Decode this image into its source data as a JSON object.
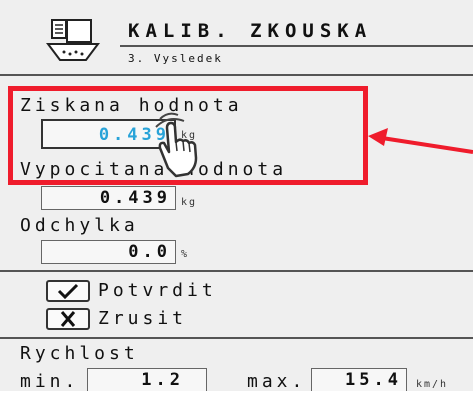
{
  "header": {
    "title": "KALIB. ZKOUSKA",
    "subtitle": "3. Vysledek"
  },
  "fields": {
    "obtained_label": "Ziskana hodnota",
    "obtained_value": "0.439",
    "obtained_unit": "kg",
    "computed_label": "Vypocitana hodnota",
    "computed_value": "0.439",
    "computed_unit": "kg",
    "deviation_label": "Odchylka",
    "deviation_value": "0.0",
    "deviation_unit": "%"
  },
  "actions": {
    "confirm_label": "Potvrdit",
    "cancel_label": "Zrusit"
  },
  "speed": {
    "label": "Rychlost",
    "min_label": "min.",
    "min_value": "1.2",
    "max_label": "max.",
    "max_value": "15.4",
    "unit": "km/h"
  },
  "colors": {
    "highlight": "#ef1c2c",
    "value_text": "#29a3d8"
  }
}
